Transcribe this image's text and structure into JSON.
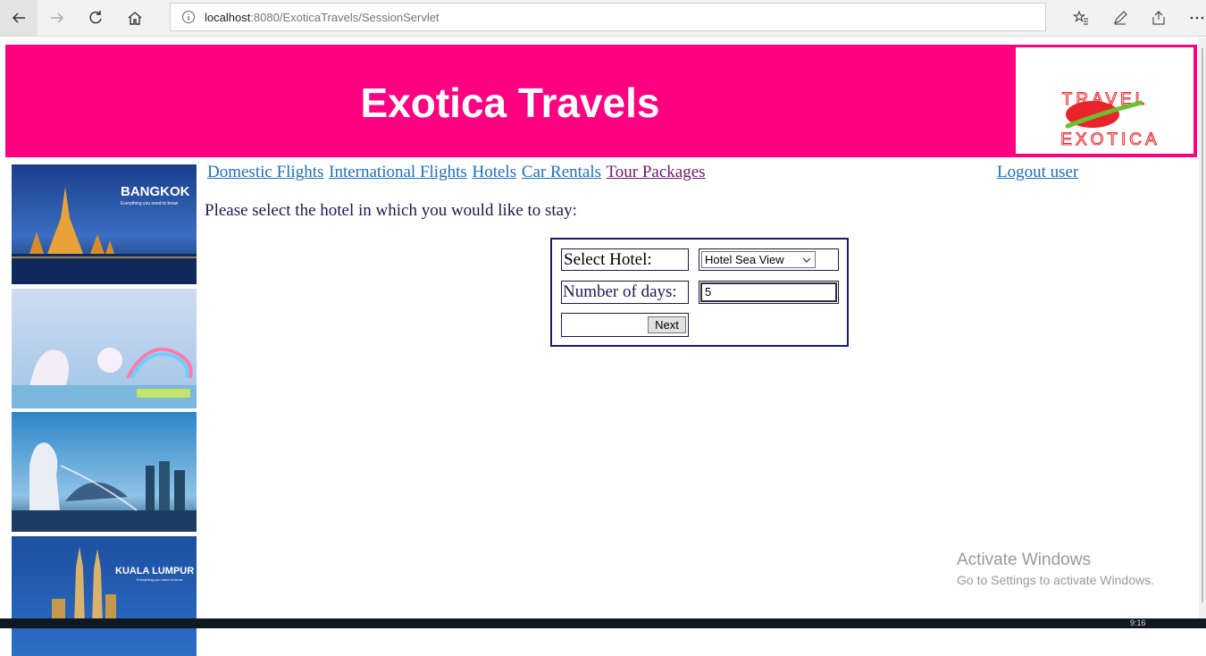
{
  "browser": {
    "url_host": "localhost",
    "url_rest": ":8080/ExoticaTravels/SessionServlet"
  },
  "banner": {
    "title": "Exotica Travels",
    "logo_top": "TRAVEL",
    "logo_bottom": "EXOTICA",
    "colors": {
      "background": "#ff0080",
      "logo_red": "#e8232a",
      "logo_green": "#6cbf2e"
    }
  },
  "thumbnails": [
    {
      "title": "BANGKOK",
      "tagline": "Everything you need to know"
    },
    {
      "title": "",
      "tagline": ""
    },
    {
      "title": "",
      "tagline": ""
    },
    {
      "title": "KUALA LUMPUR",
      "tagline": "Everything you need to know"
    }
  ],
  "menu": {
    "items": [
      {
        "label": "Domestic Flights"
      },
      {
        "label": "International Flights"
      },
      {
        "label": "Hotels"
      },
      {
        "label": "Car Rentals"
      },
      {
        "label": "Tour Packages"
      }
    ],
    "logout": "Logout user"
  },
  "main": {
    "prompt": "Please select the hotel in which you would like to stay:",
    "form": {
      "hotel_label": "Select Hotel:",
      "hotel_selected": "Hotel Sea View",
      "days_label": "Number of days:",
      "days_value": "5",
      "next_label": "Next"
    }
  },
  "watermark": {
    "line1": "Activate Windows",
    "line2": "Go to Settings to activate Windows."
  },
  "taskbar": {
    "clock": "9:16"
  }
}
